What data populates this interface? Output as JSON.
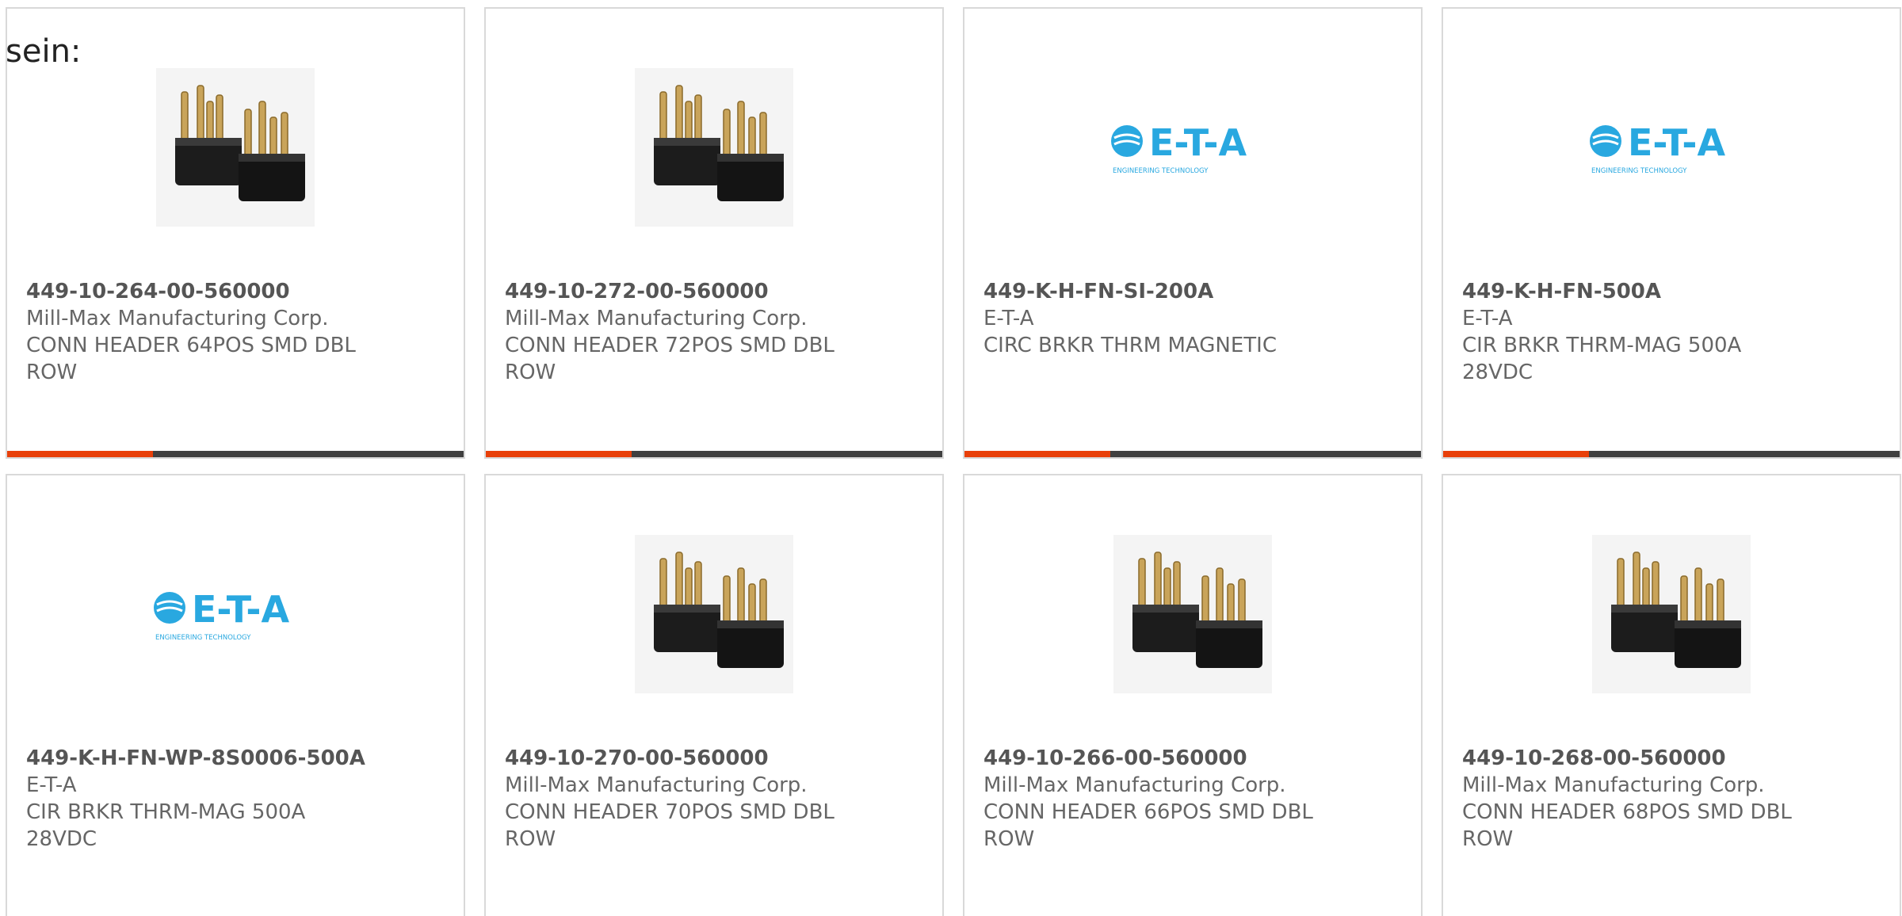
{
  "intro_text": "sein:",
  "colors": {
    "accent_bar": "#e8400a",
    "dark_bar": "#404040",
    "logo_blue": "#29a8e0",
    "border": "#d9d9d9"
  },
  "cards": [
    {
      "part_number": "449-10-264-00-560000",
      "manufacturer": "Mill-Max Manufacturing Corp.",
      "description": "CONN HEADER 64POS SMD DBL ROW",
      "image": "connector-header-icon"
    },
    {
      "part_number": "449-10-272-00-560000",
      "manufacturer": "Mill-Max Manufacturing Corp.",
      "description": "CONN HEADER 72POS SMD DBL ROW",
      "image": "connector-header-icon"
    },
    {
      "part_number": "449-K-H-FN-SI-200A",
      "manufacturer": "E-T-A",
      "description": "CIRC BRKR THRM MAGNETIC",
      "image": "eta-logo",
      "logo_text": "E-T-A",
      "logo_tagline": "ENGINEERING TECHNOLOGY"
    },
    {
      "part_number": "449-K-H-FN-500A",
      "manufacturer": "E-T-A",
      "description": "CIR BRKR THRM-MAG 500A 28VDC",
      "image": "eta-logo",
      "logo_text": "E-T-A",
      "logo_tagline": "ENGINEERING TECHNOLOGY"
    },
    {
      "part_number": "449-K-H-FN-WP-8S0006-500A",
      "manufacturer": "E-T-A",
      "description": "CIR BRKR THRM-MAG 500A 28VDC",
      "image": "eta-logo",
      "logo_text": "E-T-A",
      "logo_tagline": "ENGINEERING TECHNOLOGY"
    },
    {
      "part_number": "449-10-270-00-560000",
      "manufacturer": "Mill-Max Manufacturing Corp.",
      "description": "CONN HEADER 70POS SMD DBL ROW",
      "image": "connector-header-icon"
    },
    {
      "part_number": "449-10-266-00-560000",
      "manufacturer": "Mill-Max Manufacturing Corp.",
      "description": "CONN HEADER 66POS SMD DBL ROW",
      "image": "connector-header-icon"
    },
    {
      "part_number": "449-10-268-00-560000",
      "manufacturer": "Mill-Max Manufacturing Corp.",
      "description": "CONN HEADER 68POS SMD DBL ROW",
      "image": "connector-header-icon"
    }
  ]
}
